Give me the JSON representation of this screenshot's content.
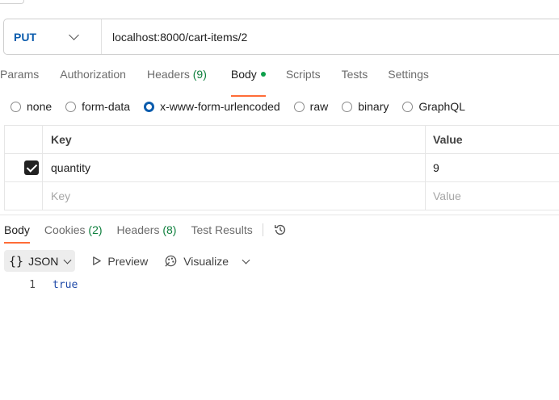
{
  "request": {
    "method": "PUT",
    "url": "localhost:8000/cart-items/2"
  },
  "request_tabs": [
    {
      "label": "Params"
    },
    {
      "label": "Authorization"
    },
    {
      "label": "Headers",
      "count": "(9)"
    },
    {
      "label": "Body",
      "active": true,
      "indicator": "green-dot"
    },
    {
      "label": "Scripts"
    },
    {
      "label": "Tests"
    },
    {
      "label": "Settings"
    }
  ],
  "body_types": [
    {
      "label": "none",
      "selected": false
    },
    {
      "label": "form-data",
      "selected": false
    },
    {
      "label": "x-www-form-urlencoded",
      "selected": true
    },
    {
      "label": "raw",
      "selected": false
    },
    {
      "label": "binary",
      "selected": false
    },
    {
      "label": "GraphQL",
      "selected": false
    }
  ],
  "kv_table": {
    "headers": {
      "key": "Key",
      "value": "Value"
    },
    "rows": [
      {
        "checked": true,
        "key": "quantity",
        "value": "9"
      }
    ],
    "placeholder": {
      "key": "Key",
      "value": "Value"
    }
  },
  "response_tabs": [
    {
      "label": "Body",
      "active": true
    },
    {
      "label": "Cookies",
      "count": "(2)"
    },
    {
      "label": "Headers",
      "count": "(8)"
    },
    {
      "label": "Test Results"
    }
  ],
  "response_toolbar": {
    "format": "JSON",
    "braces": "{}",
    "preview": "Preview",
    "visualize": "Visualize"
  },
  "response_body": {
    "line_number": "1",
    "content": "true"
  },
  "colors": {
    "method": "#0b5cad",
    "active_tab_underline": "#ff6c37",
    "count": "#0d7f3c",
    "dot": "#0da04b",
    "json_value": "#1f4aa8"
  }
}
